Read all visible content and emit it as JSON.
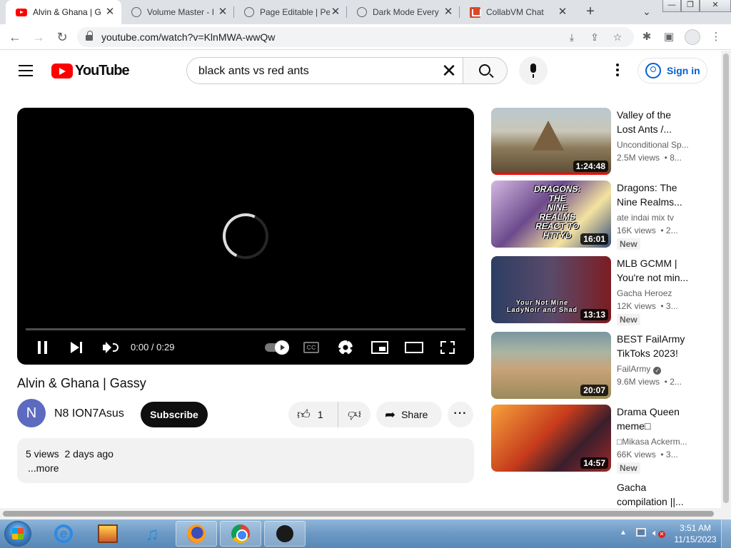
{
  "browser": {
    "tabs": [
      {
        "title": "Alvin & Ghana | G",
        "icon": "youtube-icon",
        "active": true
      },
      {
        "title": "Volume Master - I",
        "icon": "globe-icon",
        "active": false
      },
      {
        "title": "Page Editable | Pe",
        "icon": "globe-icon",
        "active": false
      },
      {
        "title": "Dark Mode Every",
        "icon": "globe-icon",
        "active": false
      },
      {
        "title": "CollabVM Chat",
        "icon": "collabvm-icon",
        "active": false
      }
    ],
    "new_tab_label": "+",
    "url": "youtube.com/watch?v=KlnMWA-wwQw"
  },
  "youtube": {
    "logo_text": "YouTube",
    "search_query": "black ants vs red ants",
    "signin_label": "Sign in",
    "player": {
      "timecode": "0:00 / 0:29",
      "progress_fraction": 0.0,
      "cc_label": "CC"
    },
    "video": {
      "title": "Alvin & Ghana | Gassy",
      "channel": "N8 ION7Asus",
      "avatar_letter": "N",
      "subscribe_label": "Subscribe",
      "like_count": "1",
      "share_label": "Share",
      "views_date": "5 views  2 days ago",
      "more_label": "...more"
    },
    "recommendations": [
      {
        "title": "Valley of the\nLost Ants /...",
        "channel": "Unconditional Sp...",
        "stats": "2.5M views  • 8...",
        "duration": "1:24:48",
        "badge": ""
      },
      {
        "title": "Dragons: The\nNine Realms...",
        "channel": "ate indai mix tv",
        "stats": "16K views  • 2...",
        "duration": "16:01",
        "badge": "New"
      },
      {
        "title": "MLB GCMM |\nYou're not min...",
        "channel": "Gacha Heroez",
        "stats": "12K views  • 3...",
        "duration": "13:13",
        "badge": "New"
      },
      {
        "title": "BEST FailArmy\nTikToks 2023!",
        "channel": "FailArmy",
        "stats": "9.6M views  • 2...",
        "duration": "20:07",
        "badge": ""
      },
      {
        "title": "Drama Queen\nmeme□",
        "channel": "□Mikasa Ackerm...",
        "stats": "66K views  • 3...",
        "duration": "14:57",
        "badge": "New"
      },
      {
        "title": "Gacha\ncompilation ||...",
        "channel": "",
        "stats": "",
        "duration": "",
        "badge": ""
      }
    ],
    "thumb_texts": {
      "dragons": "DRAGONS:\nTHE\nNINE\nREALMS\nREACT TO\nHTTYD",
      "mlb": "Your Not Mine\nLadyNoir and Shad"
    }
  },
  "taskbar": {
    "time": "3:51 AM",
    "date": "11/15/2023"
  },
  "colors": {
    "yt_red": "#ff0000",
    "link_blue": "#065fd4",
    "subscribe_bg": "#0f0f0f"
  }
}
